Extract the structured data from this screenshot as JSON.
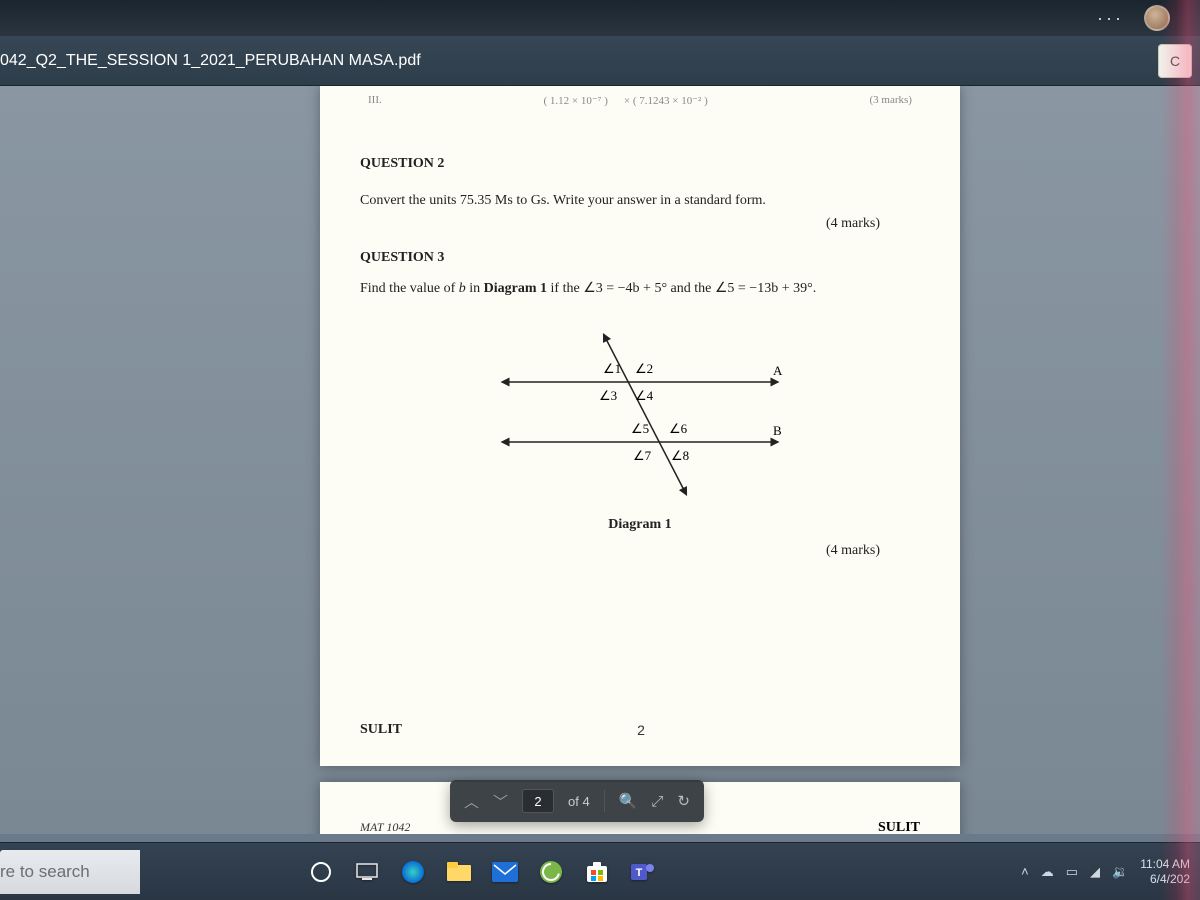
{
  "system": {
    "menu_dots": "···"
  },
  "titlebar": {
    "filename": "042_Q2_THE_SESSION 1_2021_PERUBAHAN MASA.pdf",
    "right_btn": "C"
  },
  "doc": {
    "prev_left": "III.",
    "prev_mid_a": "( 1.12 × 10⁻⁷ )",
    "prev_mid_b": "× ( 7.1243 × 10⁻² )",
    "prev_right": "(3 marks)",
    "q2_head": "QUESTION 2",
    "q2_text": "Convert the units 75.35 Ms to Gs. Write your answer in a standard form.",
    "q2_marks": "(4 marks)",
    "q3_head": "QUESTION 3",
    "q3_text_pre": "Find the value of ",
    "q3_var": "b",
    "q3_text_mid": " in ",
    "q3_bold": "Diagram 1",
    "q3_text_post": " if the ∠3 = −4b + 5° and the ∠5 = −13b + 39°.",
    "angles": {
      "a1": "∠1",
      "a2": "∠2",
      "a3": "∠3",
      "a4": "∠4",
      "a5": "∠5",
      "a6": "∠6",
      "a7": "∠7",
      "a8": "∠8",
      "A": "A",
      "B": "B"
    },
    "diag_caption": "Diagram 1",
    "q3_marks": "(4 marks)",
    "footer_sulit": "SULIT",
    "footer_page": "2",
    "next_header": "MAT 1042",
    "next_sulit": "SULIT"
  },
  "nav": {
    "page": "2",
    "total": "of 4"
  },
  "taskbar": {
    "search": "re to search",
    "clock_time": "11:04 AM",
    "clock_date": "6/4/202"
  }
}
